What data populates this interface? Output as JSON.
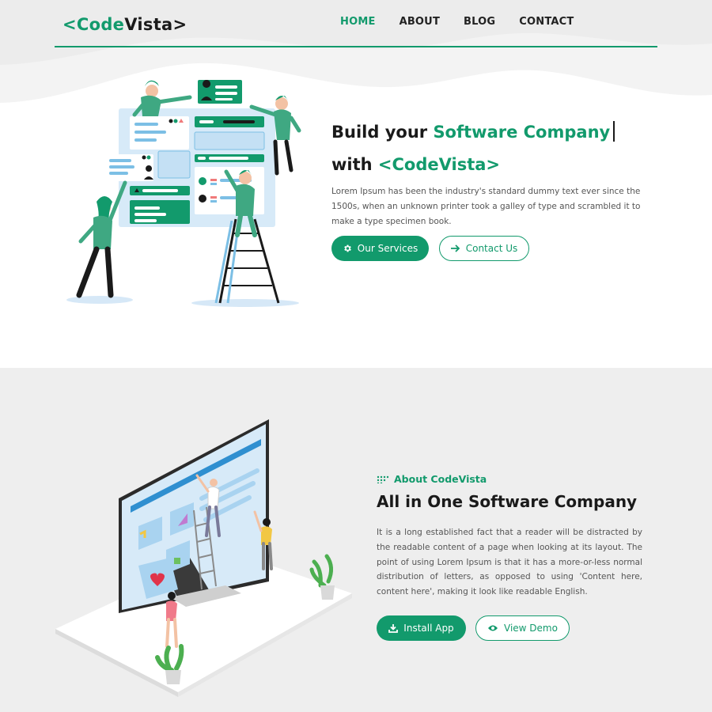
{
  "brand": {
    "open": "<",
    "name_part1": "Code",
    "name_part2": "Vista",
    "close": ">"
  },
  "nav": {
    "items": [
      {
        "label": "HOME",
        "active": true
      },
      {
        "label": "ABOUT",
        "active": false
      },
      {
        "label": "BLOG",
        "active": false
      },
      {
        "label": "CONTACT",
        "active": false
      }
    ]
  },
  "hero": {
    "title_prefix": "Build your ",
    "title_accent": "Software Company",
    "title2_prefix": "with ",
    "title2_accent": "<CodeVista>",
    "description": "Lorem Ipsum has been the industry's standard dummy text ever since the 1500s, when an unknown printer took a galley of type and scrambled it to make a type specimen book.",
    "primary_button": {
      "label": "Our Services",
      "icon": "gear-icon"
    },
    "secondary_button": {
      "label": "Contact Us",
      "icon": "arrow-right-icon"
    }
  },
  "about": {
    "kicker": "About CodeVista",
    "title": "All in One Software Company",
    "description": "It is a long established fact that a reader will be distracted by the readable content of a page when looking at its layout. The point of using Lorem Ipsum is that it has a more-or-less normal distribution of letters, as opposed to using 'Content here, content here', making it look like readable English.",
    "primary_button": {
      "label": "Install App",
      "icon": "download-icon"
    },
    "secondary_button": {
      "label": "View Demo",
      "icon": "eye-icon"
    }
  },
  "colors": {
    "accent": "#129a6c",
    "text": "#1a1a1a",
    "muted": "#555555",
    "section_bg": "#eeeeee"
  }
}
